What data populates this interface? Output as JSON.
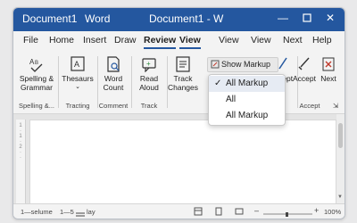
{
  "title_left": "Document1",
  "title_app": "Word",
  "title_center": "Document1 - W",
  "menu": [
    "File",
    "Home",
    "Insert",
    "Draw",
    "Review",
    "View",
    "View",
    "Next",
    "Help"
  ],
  "ribbon": {
    "spelling": "Spelling &\nGrammar",
    "thesaurus": "Thesaurs",
    "word_count": "Word\nCount",
    "read_aloud": "Read\nAloud",
    "track_changes": "Track\nChanges",
    "accept_partial": "ccept",
    "accept": "Accept",
    "next": "Next",
    "show_markup": "Show Markup"
  },
  "groups": {
    "spelling": "Spelling &...",
    "tracting": "Tracting",
    "comment": "Comment",
    "track": "Track",
    "accept": "Accept"
  },
  "dropdown": {
    "items": [
      {
        "label": "All Markup",
        "checked": true
      },
      {
        "label": "All",
        "checked": false
      },
      {
        "label": "All Markup",
        "checked": false
      }
    ]
  },
  "status": {
    "left": "1—selume",
    "mid": "1—5",
    "mid2": "lay",
    "zoom": "100%"
  },
  "colors": {
    "accent": "#24579f"
  }
}
